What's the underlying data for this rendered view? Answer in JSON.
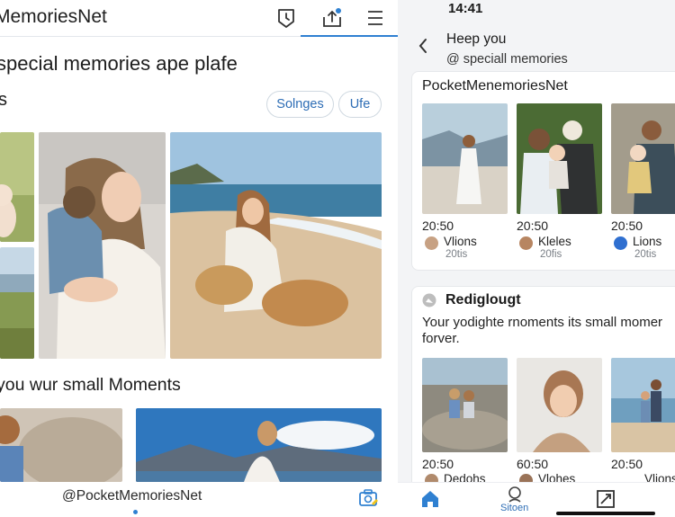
{
  "left": {
    "app_title": "MemoriesNet",
    "icons": [
      "clock-badge-icon",
      "upload-tray-icon",
      "menu-icon"
    ],
    "headline": "special memories ape plafe",
    "subhead": "s",
    "chips": [
      "Solnges",
      "Ufe"
    ],
    "section_title": "you wur small Moments",
    "handle": "@PocketMemoriesNet",
    "bottom_icon": "camera-edit-icon"
  },
  "right": {
    "status_time": "14:41",
    "chat_title": "Heep you",
    "chat_sub": "@  speciall memories",
    "card1": {
      "title": "PocketMenemoriesNet",
      "items": [
        {
          "time": "20:50",
          "name": "Vlions",
          "count": "20tis"
        },
        {
          "time": "20:50",
          "name": "Kleles",
          "count": "20fis"
        },
        {
          "time": "20:50",
          "name": "Lions",
          "count": "20tis"
        }
      ]
    },
    "card2": {
      "title": "Rediglougt",
      "body": "Your yodighte rnoments its small momer forver.",
      "items": [
        {
          "time": "20:50",
          "name": "Dedohs"
        },
        {
          "time": "60:50",
          "name": "Vlohes"
        },
        {
          "time": "20:50",
          "name": "Vlions"
        }
      ]
    },
    "nav": {
      "search_label": "Sitoen"
    }
  },
  "colors": {
    "accent": "#2f80d1",
    "chip_text": "#2d6db5"
  }
}
